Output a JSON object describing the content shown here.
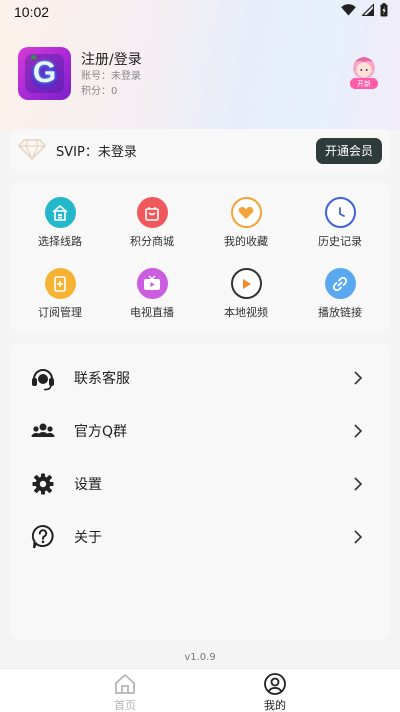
{
  "status_bar": {
    "time": "10:02"
  },
  "profile": {
    "name": "注册/登录",
    "account_label": "账号：",
    "account_value": "未登录",
    "points_label": "积分：",
    "points_value": "0",
    "logo_letter": "G",
    "avatar_badge": "开新"
  },
  "svip": {
    "status": "SVIP：未登录",
    "button": "开通会员"
  },
  "grid": {
    "items": [
      {
        "label": "选择线路",
        "icon": "route-icon",
        "color": "#22b8c9"
      },
      {
        "label": "积分商城",
        "icon": "shopping-bag-icon",
        "color": "#f0595c"
      },
      {
        "label": "我的收藏",
        "icon": "heart-icon",
        "color": "#f3a33a"
      },
      {
        "label": "历史记录",
        "icon": "clock-icon",
        "color": "#3d63e0"
      },
      {
        "label": "订阅管理",
        "icon": "subscription-icon",
        "color": "#f5b233"
      },
      {
        "label": "电视直播",
        "icon": "tv-icon",
        "color": "#cc5ce0"
      },
      {
        "label": "本地视频",
        "icon": "play-circle-icon",
        "color": "#f08a26"
      },
      {
        "label": "播放链接",
        "icon": "link-icon",
        "color": "#5aa8f0"
      }
    ]
  },
  "menu": {
    "items": [
      {
        "label": "联系客服",
        "icon": "headset-icon"
      },
      {
        "label": "官方Q群",
        "icon": "group-icon"
      },
      {
        "label": "设置",
        "icon": "gear-icon"
      },
      {
        "label": "关于",
        "icon": "help-icon"
      }
    ]
  },
  "version": "v1.0.9",
  "tabbar": {
    "tabs": [
      {
        "label": "首页",
        "icon": "home-icon",
        "active": false
      },
      {
        "label": "我的",
        "icon": "user-icon",
        "active": true
      }
    ]
  },
  "colors": {
    "accent": "#2d3b3a",
    "inactive_tab": "#b5b5b5",
    "active_tab": "#222222"
  }
}
